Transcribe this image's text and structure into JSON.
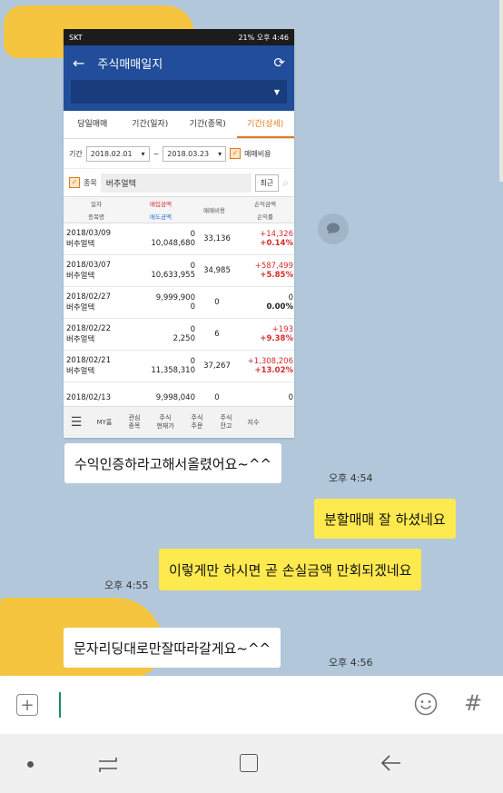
{
  "shot": {
    "status": {
      "left": "SKT",
      "right": "21% 오후 4:46"
    },
    "app_title": "주식매매일지",
    "tabs": [
      "당일매매",
      "기간(일자)",
      "기간(종목)",
      "기간(상세)"
    ],
    "period": {
      "label": "기간",
      "from": "2018.02.01",
      "tilde": "~",
      "to": "2018.03.23",
      "fee_label": "매매비용"
    },
    "stock": {
      "label": "종목",
      "name": "버추얼텍",
      "recent": "최근"
    },
    "headers": {
      "c1a": "일자",
      "c1b": "종목명",
      "c2a": "매입금액",
      "c2b": "매도금액",
      "c3": "매매비용",
      "c4a": "손익금액",
      "c4b": "손익률"
    },
    "rows": [
      {
        "date": "2018/03/09",
        "name": "버추얼텍",
        "buy": "0",
        "sell": "10,048,680",
        "fee": "33,136",
        "pl": "+14,326",
        "rate": "+0.14%",
        "red": true
      },
      {
        "date": "2018/03/07",
        "name": "버추얼텍",
        "buy": "0",
        "sell": "10,633,955",
        "fee": "34,985",
        "pl": "+587,499",
        "rate": "+5.85%",
        "red": true
      },
      {
        "date": "2018/02/27",
        "name": "버추얼텍",
        "buy": "9,999,900",
        "sell": "0",
        "fee": "0",
        "pl": "0",
        "rate": "0.00%",
        "red": false
      },
      {
        "date": "2018/02/22",
        "name": "버추얼텍",
        "buy": "0",
        "sell": "2,250",
        "fee": "6",
        "pl": "+193",
        "rate": "+9.38%",
        "red": true
      },
      {
        "date": "2018/02/21",
        "name": "버추얼텍",
        "buy": "0",
        "sell": "11,358,310",
        "fee": "37,267",
        "pl": "+1,308,206",
        "rate": "+13.02%",
        "red": true
      },
      {
        "date": "2018/02/13",
        "name": "",
        "buy": "9,998,040",
        "sell": "",
        "fee": "0",
        "pl": "0",
        "rate": "",
        "red": false
      }
    ],
    "bottom_nav": [
      "MY홈",
      "관심\n종목",
      "주식\n현재가",
      "주식\n주문",
      "주식\n잔고",
      "지수"
    ]
  },
  "messages": [
    {
      "text": "수익인증하라고해서올렸어요~^^",
      "time": "오후 4:54"
    },
    {
      "text": "분할매매 잘 하셨네요"
    },
    {
      "text": "이렇게만 하시면 곧 손실금액 만회되겠네요",
      "time": "오후 4:55"
    },
    {
      "text": "문자리딩대로만잘따라갈게요~^^",
      "time": "오후 4:56"
    }
  ],
  "colors": {
    "background": "#b2c7da",
    "my_bubble": "#fee94e",
    "app_blue": "#214d9a",
    "accent": "#e07a1b"
  }
}
